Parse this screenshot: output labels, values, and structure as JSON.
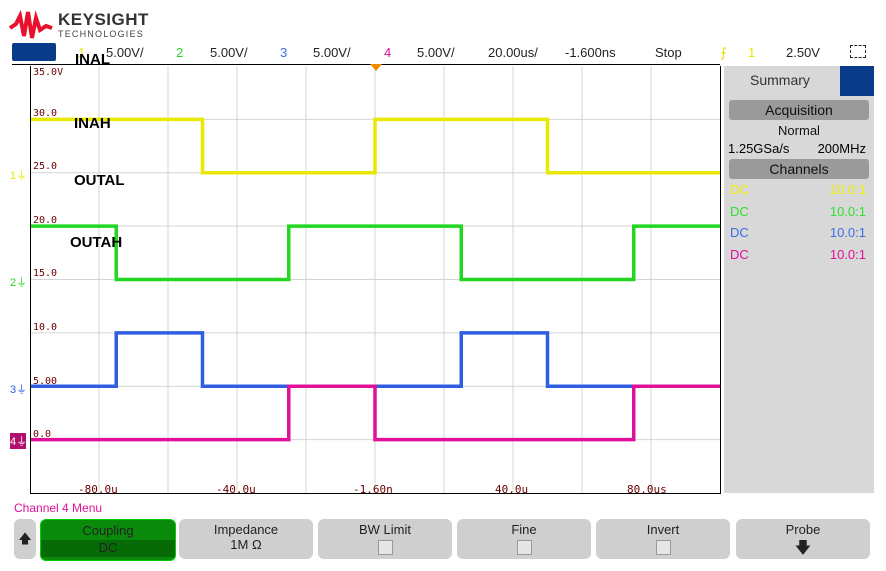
{
  "brand": {
    "name": "KEYSIGHT",
    "sub": "TECHNOLOGIES"
  },
  "header": {
    "ch1_num": "1",
    "ch1_scale": "5.00V/",
    "ch2_num": "2",
    "ch2_scale": "5.00V/",
    "ch3_num": "3",
    "ch3_scale": "5.00V/",
    "ch4_num": "4",
    "ch4_scale": "5.00V/",
    "timebase": "20.00us/",
    "delay": "-1.600ns",
    "run_state": "Stop",
    "trigger_source": "1",
    "trigger_level": "2.50V"
  },
  "labels": {
    "inal": "INAL",
    "inah": "INAH",
    "outal": "OUTAL",
    "outah": "OUTAH"
  },
  "volt_ticks": [
    "35.0V",
    "30.0",
    "25.0",
    "20.0",
    "15.0",
    "10.0",
    "5.00",
    "0.0"
  ],
  "time_ticks": [
    "-80.0u",
    "-40.0u",
    "-1.60n",
    "40.0u",
    "80.0us"
  ],
  "summary": {
    "tab": "Summary",
    "acq_label": "Acquisition",
    "acq_mode": "Normal",
    "sample_rate": "1.25GSa/s",
    "bandwidth": "200MHz",
    "channels_label": "Channels",
    "channels": [
      {
        "coupling": "DC",
        "probe": "10.0:1",
        "color": "#f0f000"
      },
      {
        "coupling": "DC",
        "probe": "10.0:1",
        "color": "#30e030"
      },
      {
        "coupling": "DC",
        "probe": "10.0:1",
        "color": "#3a6ee8"
      },
      {
        "coupling": "DC",
        "probe": "10.0:1",
        "color": "#e0109a"
      }
    ]
  },
  "menu": {
    "title": "Channel 4 Menu",
    "coupling_label": "Coupling",
    "coupling_value": "DC",
    "impedance_label": "Impedance",
    "impedance_value": "1M Ω",
    "bw_label": "BW Limit",
    "fine_label": "Fine",
    "invert_label": "Invert",
    "probe_label": "Probe"
  },
  "colors": {
    "ch1": "#e8e800",
    "ch2": "#22d622",
    "ch3": "#2f5fe0",
    "ch4": "#e0109a"
  },
  "chart_data": {
    "type": "line",
    "xlabel": "",
    "ylabel": "",
    "xunit": "us",
    "xlim": [
      -100,
      100
    ],
    "ylim": [
      -5,
      35
    ],
    "grid": true,
    "series": [
      {
        "name": "INAL",
        "channel": "1",
        "color": "#e8e800",
        "x": [
          -100,
          -50,
          -50,
          0,
          0,
          50,
          50,
          100
        ],
        "y": [
          30,
          30,
          25,
          25,
          30,
          30,
          25,
          25
        ]
      },
      {
        "name": "OUTAL",
        "channel": "2",
        "color": "#22d622",
        "x": [
          -100,
          -75,
          -75,
          -25,
          -25,
          25,
          25,
          75,
          75,
          100
        ],
        "y": [
          20,
          20,
          15,
          15,
          20,
          20,
          15,
          15,
          20,
          20
        ]
      },
      {
        "name": "",
        "channel": "3",
        "color": "#2f5fe0",
        "x": [
          -100,
          -75,
          -75,
          -50,
          -50,
          25,
          25,
          50,
          50,
          100
        ],
        "y": [
          5,
          5,
          10,
          10,
          5,
          5,
          10,
          10,
          5,
          5
        ]
      },
      {
        "name": "",
        "channel": "4",
        "color": "#e0109a",
        "x": [
          -100,
          -25,
          -25,
          0,
          0,
          75,
          75,
          100
        ],
        "y": [
          0,
          0,
          5,
          5,
          0,
          0,
          5,
          5
        ]
      }
    ]
  }
}
